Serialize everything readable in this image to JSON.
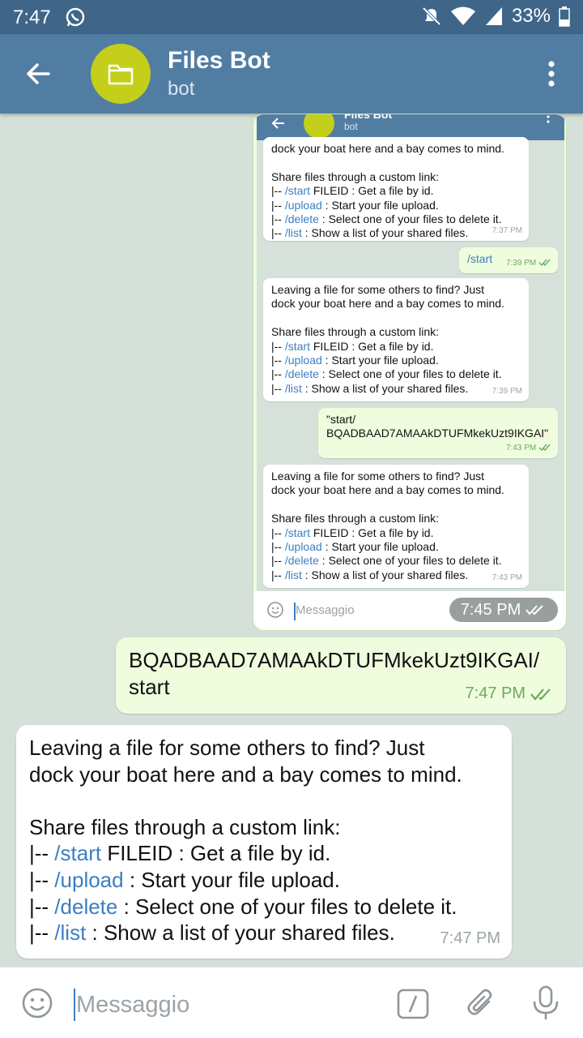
{
  "status_bar": {
    "time": "7:47",
    "battery": "33%"
  },
  "header": {
    "title": "Files Bot",
    "subtitle": "bot"
  },
  "screenshot": {
    "header_title": "Files Bot",
    "header_subtitle": "bot",
    "messages": [
      {
        "dir": "in",
        "lines": [
          "dock your boat here and a bay comes to mind.",
          "",
          "Share files through a custom link:",
          "|-- /start FILEID : Get a file by id.",
          "|-- /upload : Start your file upload.",
          "|-- /delete : Select one of your files to delete it.",
          "|-- /list : Show a list of your shared files."
        ],
        "time": "7:37 PM"
      },
      {
        "dir": "out",
        "lines": [
          "/start"
        ],
        "time": "7:39 PM"
      },
      {
        "dir": "in",
        "lines": [
          "Leaving a file for some others to find? Just",
          "dock your boat here and a bay comes to mind.",
          "",
          "Share files through a custom link:",
          "|-- /start FILEID : Get a file by id.",
          "|-- /upload : Start your file upload.",
          "|-- /delete : Select one of your files to delete it.",
          "|-- /list : Show a list of your shared files."
        ],
        "time": "7:39 PM"
      },
      {
        "dir": "out",
        "lines": [
          "\"start/",
          "BQADBAAD7AMAAkDTUFMkekUzt9IKGAI\""
        ],
        "time": "7:43 PM"
      },
      {
        "dir": "in",
        "lines": [
          "Leaving a file for some others to find? Just",
          "dock your boat here and a bay comes to mind.",
          "",
          "Share files through a custom link:",
          "|-- /start FILEID : Get a file by id.",
          "|-- /upload : Start your file upload.",
          "|-- /delete : Select one of your files to delete it.",
          "|-- /list : Show a list of your shared files."
        ],
        "time": "7:43 PM"
      }
    ],
    "input_placeholder": "Messaggio",
    "image_time": "7:45 PM"
  },
  "messages": [
    {
      "dir": "out",
      "lines": [
        "BQADBAAD7AMAAkDTUFMkekUzt9IKGAI/",
        "start"
      ],
      "time": "7:47 PM"
    },
    {
      "dir": "in",
      "lines": [
        "Leaving a file for some others to find? Just",
        "dock your boat here and a bay comes to mind.",
        "",
        "Share files through a custom link:",
        "|-- /start FILEID : Get a file by id.",
        "|-- /upload : Start your file upload.",
        "|-- /delete : Select one of your files to delete it.",
        "|-- /list : Show a list of your shared files."
      ],
      "time": "7:47 PM"
    }
  ],
  "input": {
    "placeholder": "Messaggio"
  },
  "icons": [
    "back-arrow-icon",
    "folder-icon",
    "more-vert-icon",
    "emoji-icon",
    "bot-command-icon",
    "attach-icon",
    "mic-icon",
    "double-check-icon",
    "whatsapp-icon",
    "mute-icon",
    "wifi-icon",
    "signal-icon",
    "battery-icon"
  ],
  "colors": {
    "header": "#527da3",
    "status_bar": "#3f6689",
    "avatar": "#c3cf1a",
    "out_bubble": "#effdde",
    "link": "#3a7fc4",
    "out_time": "#6aaa63"
  }
}
